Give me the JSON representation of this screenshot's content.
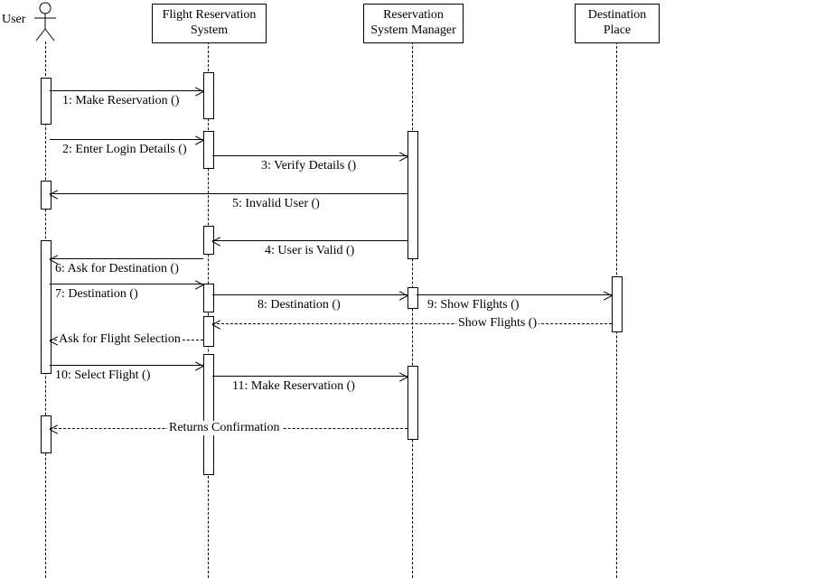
{
  "participants": {
    "user": {
      "label": "User"
    },
    "frs": {
      "label": "Flight Reservation\nSystem"
    },
    "rsm": {
      "label": "Reservation\nSystem Manager"
    },
    "dest": {
      "label": "Destination\nPlace"
    }
  },
  "messages": {
    "m1": "1: Make Reservation ()",
    "m2": "2: Enter Login Details ()",
    "m3": "3: Verify Details ()",
    "m4": "4: User is Valid ()",
    "m5": "5: Invalid User ()",
    "m6": "6: Ask for Destination ()",
    "m7": "7: Destination ()",
    "m8": "8: Destination ()",
    "m9": "9: Show Flights ()",
    "r_show": "Show Flights ()",
    "r_askSel": "Ask for Flight Selection",
    "m10": "10: Select Flight ()",
    "m11": "11: Make Reservation ()",
    "r_conf": "Returns Confirmation"
  }
}
